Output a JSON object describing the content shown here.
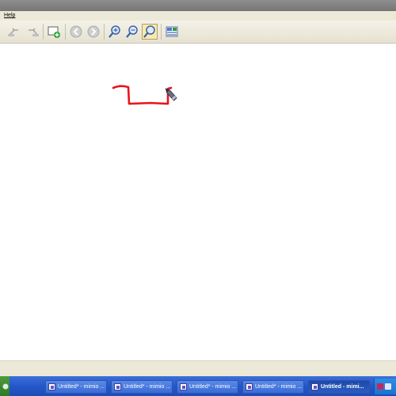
{
  "menu": {
    "help_label": "Help"
  },
  "toolbar": {
    "buttons": [
      {
        "icon": "undo-icon"
      },
      {
        "icon": "redo-icon"
      },
      {
        "icon": "add-page-icon"
      },
      {
        "icon": "previous-page-icon"
      },
      {
        "icon": "next-page-icon"
      },
      {
        "icon": "zoom-in-icon"
      },
      {
        "icon": "zoom-out-icon"
      },
      {
        "icon": "zoom-tool-icon",
        "active": true
      },
      {
        "icon": "gallery-icon"
      }
    ]
  },
  "canvas": {
    "stroke_color": "#e8131a"
  },
  "taskbar": {
    "buttons": [
      {
        "label": "Untitled* - mimio ..."
      },
      {
        "label": "Untitled* - mimio ..."
      },
      {
        "label": "Untitled* - mimio ..."
      },
      {
        "label": "Untitled* - mimio ..."
      },
      {
        "label": "Untitled - mimi...",
        "active": true
      }
    ]
  },
  "colors": {
    "toolbar_bg": "#ece9d8",
    "taskbar_blue": "#2457c9",
    "active_highlight": "#fbe9a8"
  }
}
